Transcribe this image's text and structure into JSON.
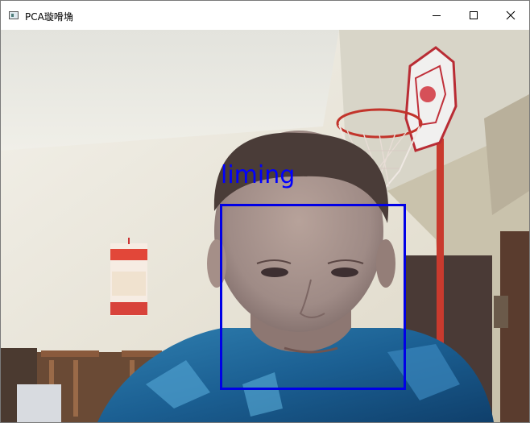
{
  "window": {
    "title": "PCA璇嗗埆",
    "controls": {
      "minimize_icon": "minimize-icon",
      "maximize_icon": "maximize-icon",
      "close_icon": "close-icon"
    }
  },
  "camera": {
    "detections": [
      {
        "label": "liming",
        "box_color": "#0000ff"
      }
    ]
  },
  "colors": {
    "detection": "#0000ff",
    "titlebar_bg": "#ffffff"
  }
}
